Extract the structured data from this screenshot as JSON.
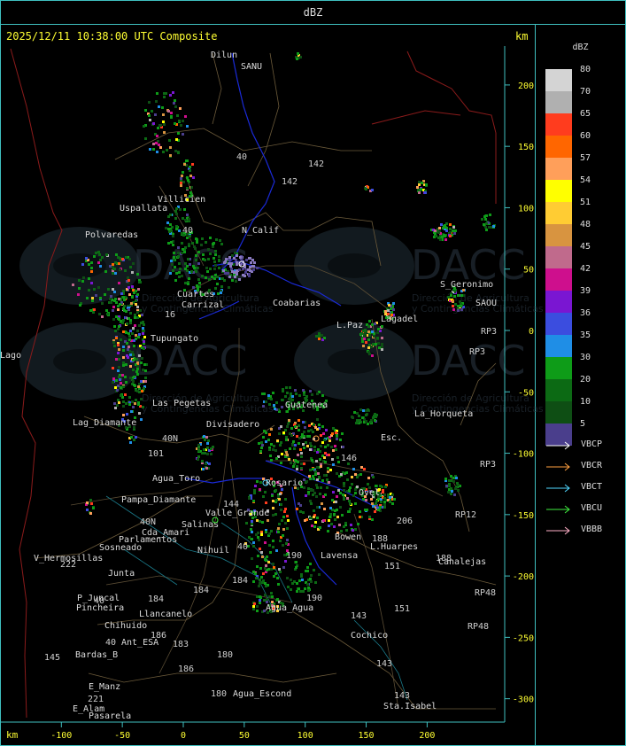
{
  "header": {
    "product": "dBZ",
    "timestamp": "2025/12/11 10:38:00 UTC Composite",
    "km_top": "km",
    "km_bottom": "km"
  },
  "legend": {
    "title": "dBZ",
    "scale": [
      {
        "value": "80",
        "color": "#d4d4d4"
      },
      {
        "value": "70",
        "color": "#b0b0b0"
      },
      {
        "value": "65",
        "color": "#ff3c1e"
      },
      {
        "value": "60",
        "color": "#ff6600"
      },
      {
        "value": "57",
        "color": "#ff9f5a"
      },
      {
        "value": "54",
        "color": "#ffff00"
      },
      {
        "value": "51",
        "color": "#ffcc33"
      },
      {
        "value": "48",
        "color": "#d89440"
      },
      {
        "value": "45",
        "color": "#c06a8c"
      },
      {
        "value": "42",
        "color": "#ce0f8d"
      },
      {
        "value": "39",
        "color": "#7a16d2"
      },
      {
        "value": "36",
        "color": "#3b4ddf"
      },
      {
        "value": "35",
        "color": "#1f8ee6"
      },
      {
        "value": "30",
        "color": "#0e9c18"
      },
      {
        "value": "20",
        "color": "#0c6a14"
      },
      {
        "value": "10",
        "color": "#0e4e14"
      },
      {
        "value": "5",
        "color": "#4a3e8c"
      }
    ],
    "radars": [
      {
        "name": "VBCP",
        "color": "#ffffff"
      },
      {
        "name": "VBCR",
        "color": "#ffa040"
      },
      {
        "name": "VBCT",
        "color": "#50d8ff"
      },
      {
        "name": "VBCU",
        "color": "#40ee40"
      },
      {
        "name": "VBBB",
        "color": "#ffb0c8"
      }
    ]
  },
  "axes": {
    "x_ticks": [
      "-100",
      "-50",
      "0",
      "50",
      "100",
      "150",
      "200"
    ],
    "y_ticks": [
      "200",
      "150",
      "100",
      "50",
      "0",
      "-50",
      "-100",
      "-150",
      "-200",
      "-250",
      "-300"
    ]
  },
  "watermark": {
    "brand": "DACC",
    "line1": "Dirección de Agricultura",
    "line2": "y Contingencias Climáticas"
  },
  "places": [
    {
      "text": "Dilun"
    },
    {
      "text": "SANU"
    },
    {
      "text": "Uspallata"
    },
    {
      "text": "Polvaredas"
    },
    {
      "text": "Villicien"
    },
    {
      "text": "N_Calif"
    },
    {
      "text": "Cuartes"
    },
    {
      "text": "Carrizal"
    },
    {
      "text": "Coabarias"
    },
    {
      "text": "Tupungato"
    },
    {
      "text": "Las Pegetas"
    },
    {
      "text": "Divisadero"
    },
    {
      "text": "Lag_Diamante"
    },
    {
      "text": "Agua_Toro"
    },
    {
      "text": "Pampa_Diamante"
    },
    {
      "text": "Salinas"
    },
    {
      "text": "Cda_Amari"
    },
    {
      "text": "Nihuil"
    },
    {
      "text": "Valle_Grande"
    },
    {
      "text": "Parlamentos"
    },
    {
      "text": "Sosneado"
    },
    {
      "text": "V_Hermosillas"
    },
    {
      "text": "Junta"
    },
    {
      "text": "P_Juncal"
    },
    {
      "text": "Pincheira"
    },
    {
      "text": "Llancanelo"
    },
    {
      "text": "Chihuido"
    },
    {
      "text": "Ant_ESA"
    },
    {
      "text": "Bardas_B"
    },
    {
      "text": "E_Manz"
    },
    {
      "text": "E_Alam"
    },
    {
      "text": "Pasarela"
    },
    {
      "text": "Agua_Escond"
    },
    {
      "text": "Sta.Isabel"
    },
    {
      "text": "Cochico"
    },
    {
      "text": "Agua_Agua"
    },
    {
      "text": "Bowen"
    },
    {
      "text": "Lavensa"
    },
    {
      "text": "L.Huarpes"
    },
    {
      "text": "Canalejas"
    },
    {
      "text": "La_Horqueta"
    },
    {
      "text": "S_Geronimo"
    },
    {
      "text": "SAOU"
    },
    {
      "text": "Lagadel"
    },
    {
      "text": "L.Paz"
    },
    {
      "text": "Esc."
    },
    {
      "text": "Ovel"
    },
    {
      "text": "Guatenea"
    },
    {
      "text": "Rosario"
    },
    {
      "text": "Lago"
    }
  ],
  "roads": [
    {
      "text": "142"
    },
    {
      "text": "142"
    },
    {
      "text": "40"
    },
    {
      "text": "40"
    },
    {
      "text": "146"
    },
    {
      "text": "RP3"
    },
    {
      "text": "RP3"
    },
    {
      "text": "RP3"
    },
    {
      "text": "RP12"
    },
    {
      "text": "206"
    },
    {
      "text": "188"
    },
    {
      "text": "151"
    },
    {
      "text": "151"
    },
    {
      "text": "143"
    },
    {
      "text": "143"
    },
    {
      "text": "143"
    },
    {
      "text": "RP48"
    },
    {
      "text": "RP48"
    },
    {
      "text": "188"
    },
    {
      "text": "184"
    },
    {
      "text": "184"
    },
    {
      "text": "184"
    },
    {
      "text": "180"
    },
    {
      "text": "180"
    },
    {
      "text": "186"
    },
    {
      "text": "186"
    },
    {
      "text": "183"
    },
    {
      "text": "40"
    },
    {
      "text": "40"
    },
    {
      "text": "40N"
    },
    {
      "text": "145"
    },
    {
      "text": "222"
    },
    {
      "text": "221"
    },
    {
      "text": "190"
    },
    {
      "text": "101"
    },
    {
      "text": "144"
    },
    {
      "text": "40N"
    },
    {
      "text": "16"
    },
    {
      "text": "190"
    },
    {
      "text": "40"
    }
  ]
}
